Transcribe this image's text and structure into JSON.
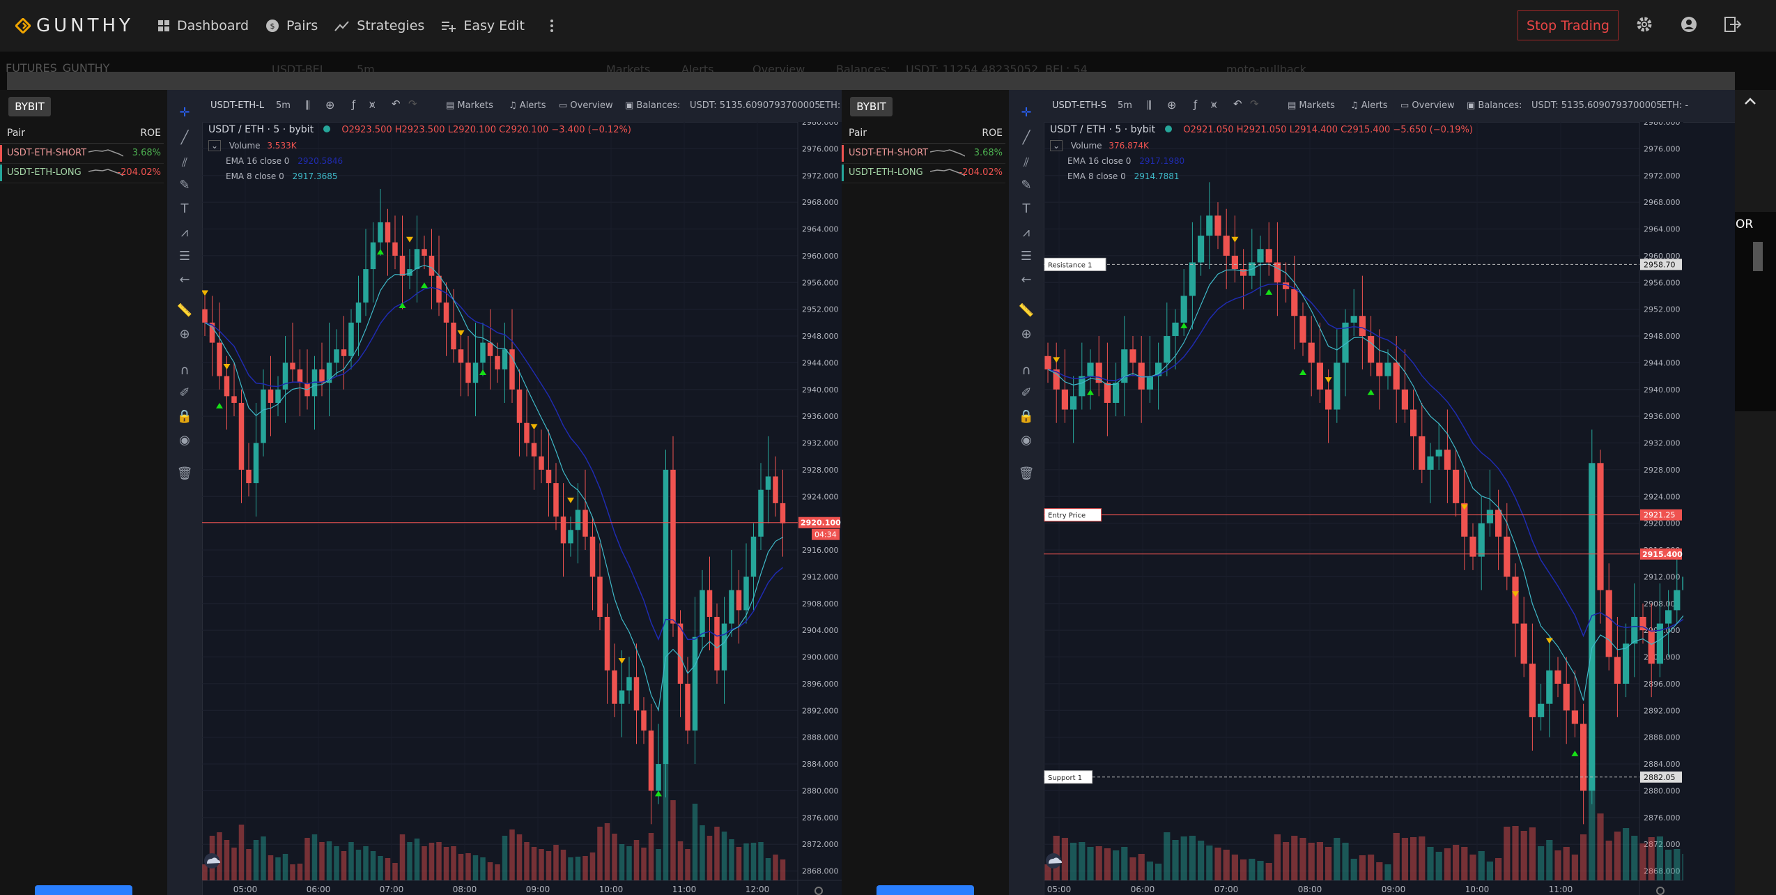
{
  "nav": {
    "brand": "GUNTHY",
    "items": [
      {
        "label": "Dashboard",
        "icon": "grid-icon"
      },
      {
        "label": "Pairs",
        "icon": "coin-icon"
      },
      {
        "label": "Strategies",
        "icon": "trend-icon"
      },
      {
        "label": "Easy Edit",
        "icon": "playlist-add-icon"
      }
    ],
    "stop_label": "Stop Trading"
  },
  "underlay": {
    "title": "FUTURES_GUNTHY",
    "pair": "USDT-BEL",
    "tf": "5m",
    "markets": "Markets",
    "alerts": "Alerts",
    "overview": "Overview",
    "balances": "Balances:",
    "usdt": "USDT: 11254.48235052",
    "bel": "BEL: 54",
    "strategy": "moto-pullback"
  },
  "right_tab_label": "OR",
  "colors": {
    "up": "#26a69a",
    "down": "#ef5350",
    "ema16": "#1f2bb0",
    "ema8": "#3fb9c8",
    "buy_signal": "#16e016",
    "sell_signal": "#f0b400"
  },
  "panes": [
    {
      "exchange": "BYBIT",
      "pair_header": "Pair",
      "roe_header": "ROE",
      "pairs": [
        {
          "symbol": "USDT-ETH-SHORT",
          "roe": "3.68%",
          "roe_color": "#4caf50",
          "bar": "#ef5350"
        },
        {
          "symbol": "USDT-ETH-LONG",
          "roe": "-204.02%",
          "roe_color": "#ef5350",
          "bar": "#26a69a"
        }
      ],
      "toolbar": {
        "symbol": "USDT-ETH-L",
        "tf": "5m",
        "markets": "Markets",
        "alerts": "Alerts",
        "overview": "Overview",
        "balances": "Balances:",
        "usdt": "USDT: 5135.6090793700005",
        "eth": "ETH: -"
      },
      "legend": {
        "title": "USDT / ETH · 5 · bybit",
        "o": "O2923.500",
        "h": "H2923.500",
        "l": "L2920.100",
        "c": "C2920.100",
        "chg": "−3.400 (−0.12%)",
        "volume_label": "Volume",
        "volume_value": "3.533K",
        "ema16_label": "EMA 16 close 0",
        "ema16_value": "2920.5846",
        "ema8_label": "EMA 8 close 0",
        "ema8_value": "2917.3685"
      },
      "price_badge": "2920.100",
      "countdown": "04:34",
      "lines": []
    },
    {
      "exchange": "BYBIT",
      "pair_header": "Pair",
      "roe_header": "ROE",
      "pairs": [
        {
          "symbol": "USDT-ETH-SHORT",
          "roe": "3.68%",
          "roe_color": "#4caf50",
          "bar": "#ef5350"
        },
        {
          "symbol": "USDT-ETH-LONG",
          "roe": "-204.02%",
          "roe_color": "#ef5350",
          "bar": "#26a69a"
        }
      ],
      "toolbar": {
        "symbol": "USDT-ETH-S",
        "tf": "5m",
        "markets": "Markets",
        "alerts": "Alerts",
        "overview": "Overview",
        "balances": "Balances:",
        "usdt": "USDT: 5135.6090793700005",
        "eth": "ETH: -"
      },
      "legend": {
        "title": "USDT / ETH · 5 · bybit",
        "o": "O2921.050",
        "h": "H2921.050",
        "l": "L2914.400",
        "c": "C2915.400",
        "chg": "−5.650 (−0.19%)",
        "volume_label": "Volume",
        "volume_value": "376.874K",
        "ema16_label": "EMA 16 close 0",
        "ema16_value": "2917.1980",
        "ema8_label": "EMA 8 close 0",
        "ema8_value": "2914.7881"
      },
      "price_badge": "2915.400",
      "countdown": "",
      "lines": [
        {
          "label": "Resistance 1",
          "price": 2958.7,
          "badge": "2958.70",
          "style": "dashed",
          "color": "#bbbbbb"
        },
        {
          "label": "Entry Price",
          "price": 2921.25,
          "badge": "2921.25",
          "style": "solid",
          "color": "#ef5350"
        },
        {
          "label": "Support 1",
          "price": 2882.05,
          "badge": "2882.05",
          "style": "dashed",
          "color": "#bbbbbb"
        }
      ]
    }
  ],
  "chart_data": [
    {
      "type": "candlestick",
      "title": "USDT / ETH · 5 · bybit",
      "x_ticks": [
        "05:00",
        "06:00",
        "07:00",
        "08:00",
        "09:00",
        "10:00",
        "11:00",
        "12:00"
      ],
      "y_ticks": [
        "2980.000",
        "2976.000",
        "2972.000",
        "2968.000",
        "2964.000",
        "2960.000",
        "2956.000",
        "2952.000",
        "2948.000",
        "2944.000",
        "2940.000",
        "2936.000",
        "2932.000",
        "2928.000",
        "2924.000",
        "2920.000",
        "2916.000",
        "2912.000",
        "2908.000",
        "2904.000",
        "2900.000",
        "2896.000",
        "2892.000",
        "2888.000",
        "2884.000",
        "2880.000",
        "2876.000",
        "2872.000",
        "2868.000"
      ],
      "ylim": [
        2866.6,
        2980
      ],
      "last_price": 2920.1
    },
    {
      "type": "candlestick",
      "title": "USDT / ETH · 5 · bybit",
      "x_ticks": [
        "05:00",
        "06:00",
        "07:00",
        "08:00",
        "09:00",
        "10:00",
        "11:00"
      ],
      "y_ticks": [
        "2980.000",
        "2976.000",
        "2972.000",
        "2968.000",
        "2964.000",
        "2960.000",
        "2956.000",
        "2952.000",
        "2948.000",
        "2944.000",
        "2940.000",
        "2936.000",
        "2932.000",
        "2928.000",
        "2924.000",
        "2920.000",
        "2916.000",
        "2912.000",
        "2908.000",
        "2904.000",
        "2900.000",
        "2896.000",
        "2892.000",
        "2888.000",
        "2884.000",
        "2880.000",
        "2876.000",
        "2872.000",
        "2868.000"
      ],
      "ylim": [
        2866.6,
        2980
      ],
      "last_price": 2915.4
    }
  ],
  "candles": [
    [
      2950,
      2947,
      2942,
      2939,
      2938,
      2928,
      2926,
      2932,
      2940,
      2938,
      2940,
      2944,
      2943,
      2941,
      2939,
      2943,
      2941,
      2944,
      2946,
      2945,
      2950,
      2953,
      2958,
      2962,
      2965,
      2962,
      2960,
      2957,
      2958,
      2961,
      2960,
      2957,
      2953,
      2950,
      2946,
      2944,
      2941,
      2944,
      2947,
      2945,
      2943,
      2946,
      2940,
      2935,
      2932,
      2930,
      2928,
      2926,
      2921,
      2917,
      2919,
      2922,
      2918,
      2912,
      2906,
      2898,
      2893,
      2895,
      2897,
      2892,
      2889,
      2880,
      2884,
      2928,
      2905,
      2896,
      2889,
      2903,
      2910,
      2906,
      2898,
      2905,
      2910,
      2907,
      2912,
      2918,
      2925,
      2927,
      2923,
      2920
    ],
    [
      2943,
      2940,
      2937,
      2939,
      2942,
      2944,
      2941,
      2938,
      2941,
      2946,
      2944,
      2940,
      2942,
      2944,
      2948,
      2950,
      2954,
      2959,
      2963,
      2966,
      2963,
      2960,
      2958,
      2957,
      2959,
      2961,
      2959,
      2956,
      2955,
      2951,
      2947,
      2944,
      2940,
      2937,
      2944,
      2950,
      2951,
      2948,
      2944,
      2942,
      2944,
      2940,
      2937,
      2933,
      2928,
      2930,
      2931,
      2928,
      2923,
      2918,
      2915,
      2920,
      2922,
      2918,
      2912,
      2905,
      2899,
      2891,
      2893,
      2898,
      2896,
      2892,
      2890,
      2880,
      2929,
      2910,
      2900,
      2896,
      2902,
      2906,
      2904,
      2899,
      2905,
      2907,
      2910,
      2912,
      2918,
      2924,
      2924,
      2915
    ]
  ]
}
